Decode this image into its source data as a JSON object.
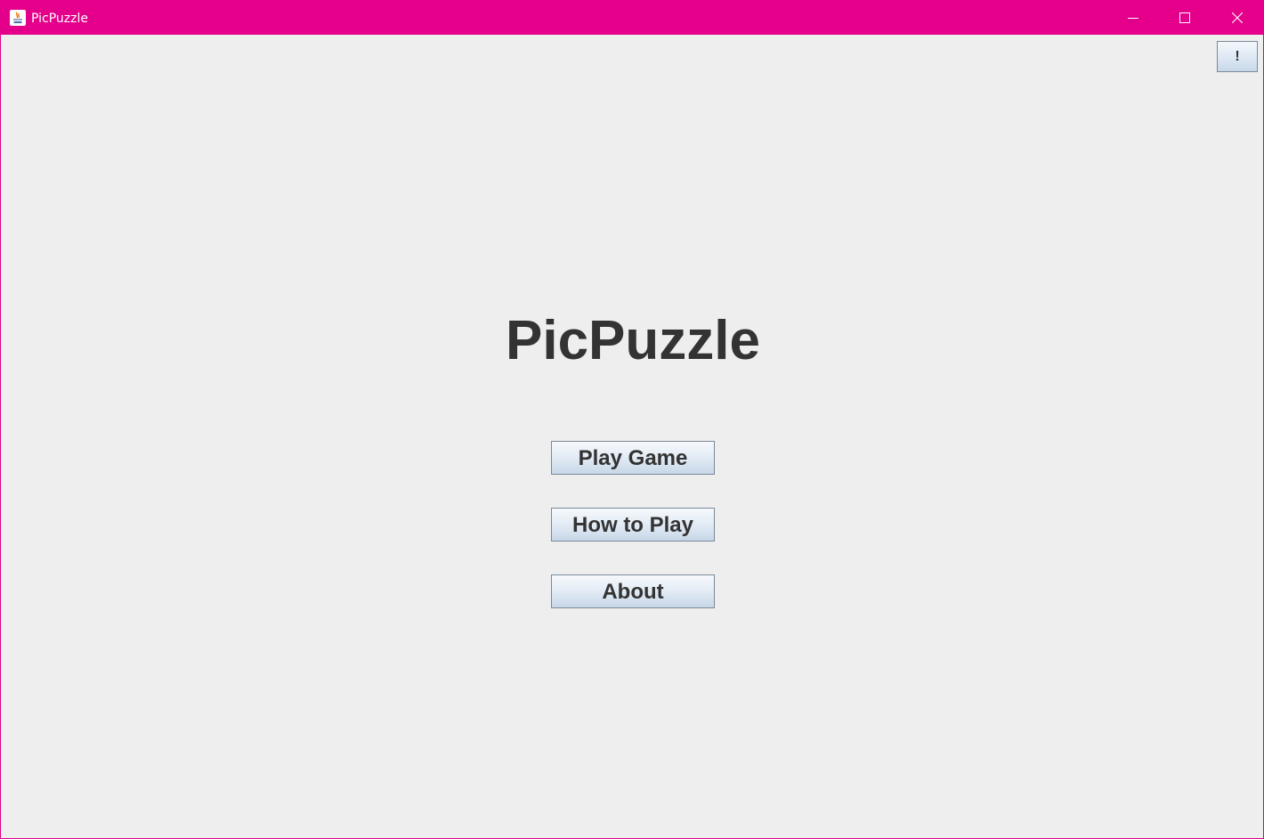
{
  "window": {
    "title": "PicPuzzle",
    "accent_color": "#e4008a",
    "icons": {
      "app": "java-icon",
      "minimize": "minimize-icon",
      "maximize": "maximize-icon",
      "close": "close-icon"
    }
  },
  "toolbar": {
    "alert_label": "!"
  },
  "main": {
    "title": "PicPuzzle",
    "buttons": {
      "play": "Play Game",
      "how_to_play": "How to Play",
      "about": "About"
    }
  }
}
